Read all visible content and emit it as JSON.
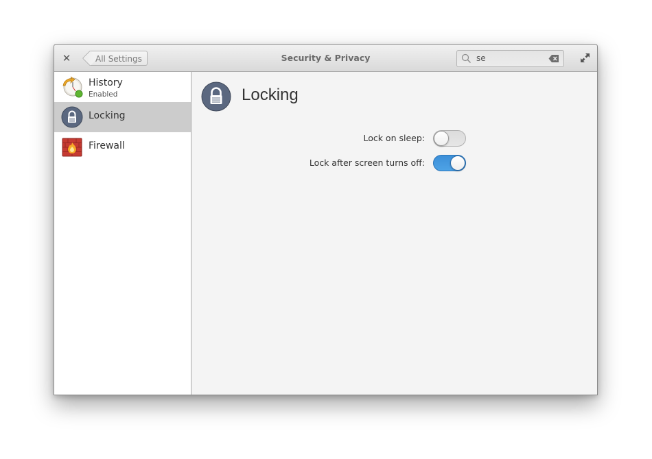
{
  "window": {
    "title": "Security & Privacy",
    "back_label": "All Settings",
    "close_icon": "close-icon",
    "maximize_icon": "maximize-icon"
  },
  "search": {
    "value": "se",
    "placeholder": "Search",
    "icon": "search-icon",
    "clear_icon": "clear-text-icon"
  },
  "sidebar": {
    "items": [
      {
        "label": "History",
        "sublabel": "Enabled",
        "icon": "history-icon",
        "selected": false
      },
      {
        "label": "Locking",
        "sublabel": "",
        "icon": "lock-icon",
        "selected": true
      },
      {
        "label": "Firewall",
        "sublabel": "",
        "icon": "firewall-icon",
        "selected": false
      }
    ]
  },
  "page": {
    "title": "Locking",
    "icon": "lock-icon",
    "settings": [
      {
        "label": "Lock on sleep:",
        "enabled": false
      },
      {
        "label": "Lock after screen turns off:",
        "enabled": true
      }
    ]
  },
  "colors": {
    "accent": "#3d8fd9",
    "selected_row": "#cccccc",
    "lock_icon_bg": "#5b6880"
  }
}
